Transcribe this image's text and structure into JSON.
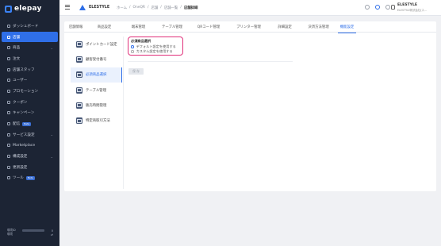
{
  "sidebar": {
    "logo_text": "elepay",
    "items": [
      {
        "label": "ダッシュボード",
        "icon": "dashboard-icon",
        "active": false,
        "chevron": false,
        "badge": ""
      },
      {
        "label": "店舗",
        "icon": "store-icon",
        "active": true,
        "chevron": false,
        "badge": ""
      },
      {
        "label": "商品",
        "icon": "product-icon",
        "active": false,
        "chevron": true,
        "badge": ""
      },
      {
        "label": "注文",
        "icon": "order-icon",
        "active": false,
        "chevron": false,
        "badge": ""
      },
      {
        "label": "店舗スタッフ",
        "icon": "staff-icon",
        "active": false,
        "chevron": false,
        "badge": ""
      },
      {
        "label": "ユーザー",
        "icon": "user-icon",
        "active": false,
        "chevron": false,
        "badge": ""
      },
      {
        "label": "プロモーション",
        "icon": "promotion-icon",
        "active": false,
        "chevron": false,
        "badge": ""
      },
      {
        "label": "クーポン",
        "icon": "coupon-icon",
        "active": false,
        "chevron": false,
        "badge": ""
      },
      {
        "label": "キャンペーン",
        "icon": "campaign-icon",
        "active": false,
        "chevron": false,
        "badge": ""
      },
      {
        "label": "配信",
        "icon": "broadcast-icon",
        "active": false,
        "chevron": false,
        "badge": "Beta"
      },
      {
        "label": "サービス設定",
        "icon": "service-settings-icon",
        "active": false,
        "chevron": true,
        "badge": ""
      },
      {
        "label": "Marketplace",
        "icon": "marketplace-icon",
        "active": false,
        "chevron": false,
        "badge": ""
      },
      {
        "label": "構成設定",
        "icon": "config-icon",
        "active": false,
        "chevron": true,
        "badge": ""
      },
      {
        "label": "更新設定",
        "icon": "update-settings-icon",
        "active": false,
        "chevron": false,
        "badge": ""
      },
      {
        "label": "ツール",
        "icon": "tool-icon",
        "active": false,
        "chevron": false,
        "badge": "Beta"
      }
    ],
    "footer": {
      "row1_label": "環境ID",
      "row1_value": "0",
      "row2_label": "環境",
      "row2_value": "⇄"
    }
  },
  "header": {
    "brand": "ELESTYLE",
    "breadcrumb": [
      "ホーム",
      "OneQR",
      "店舗",
      "店舗一覧",
      "店舗詳細"
    ],
    "user_name": "ELESTYLE",
    "user_sub": "ELESTYLE株式会社(ス..."
  },
  "tabs": [
    {
      "label": "店舗情報",
      "active": false
    },
    {
      "label": "商品設定",
      "active": false
    },
    {
      "label": "端末管理",
      "active": false
    },
    {
      "label": "テーブル管理",
      "active": false
    },
    {
      "label": "QRコード管理",
      "active": false
    },
    {
      "label": "プリンター管理",
      "active": false
    },
    {
      "label": "詳細設定",
      "active": false
    },
    {
      "label": "決済方法管理",
      "active": false
    },
    {
      "label": "機能設定",
      "active": true
    }
  ],
  "subnav": [
    {
      "label": "ポイントカード設定",
      "active": false
    },
    {
      "label": "顧客受付番号",
      "active": false
    },
    {
      "label": "必須商品選択",
      "active": true
    },
    {
      "label": "テーブル管理",
      "active": false
    },
    {
      "label": "販売時間管理",
      "active": false
    },
    {
      "label": "特定商取引方法",
      "active": false
    }
  ],
  "content": {
    "title": "必須商品選択",
    "options": [
      "デフォルト設定を使用する",
      "カスタム設定を使用する"
    ],
    "selected_option": 0,
    "save_label": "保 存"
  },
  "colors": {
    "accent": "#2f6fe8",
    "sidebar_bg": "#1c2434",
    "highlight": "#e0307a"
  }
}
